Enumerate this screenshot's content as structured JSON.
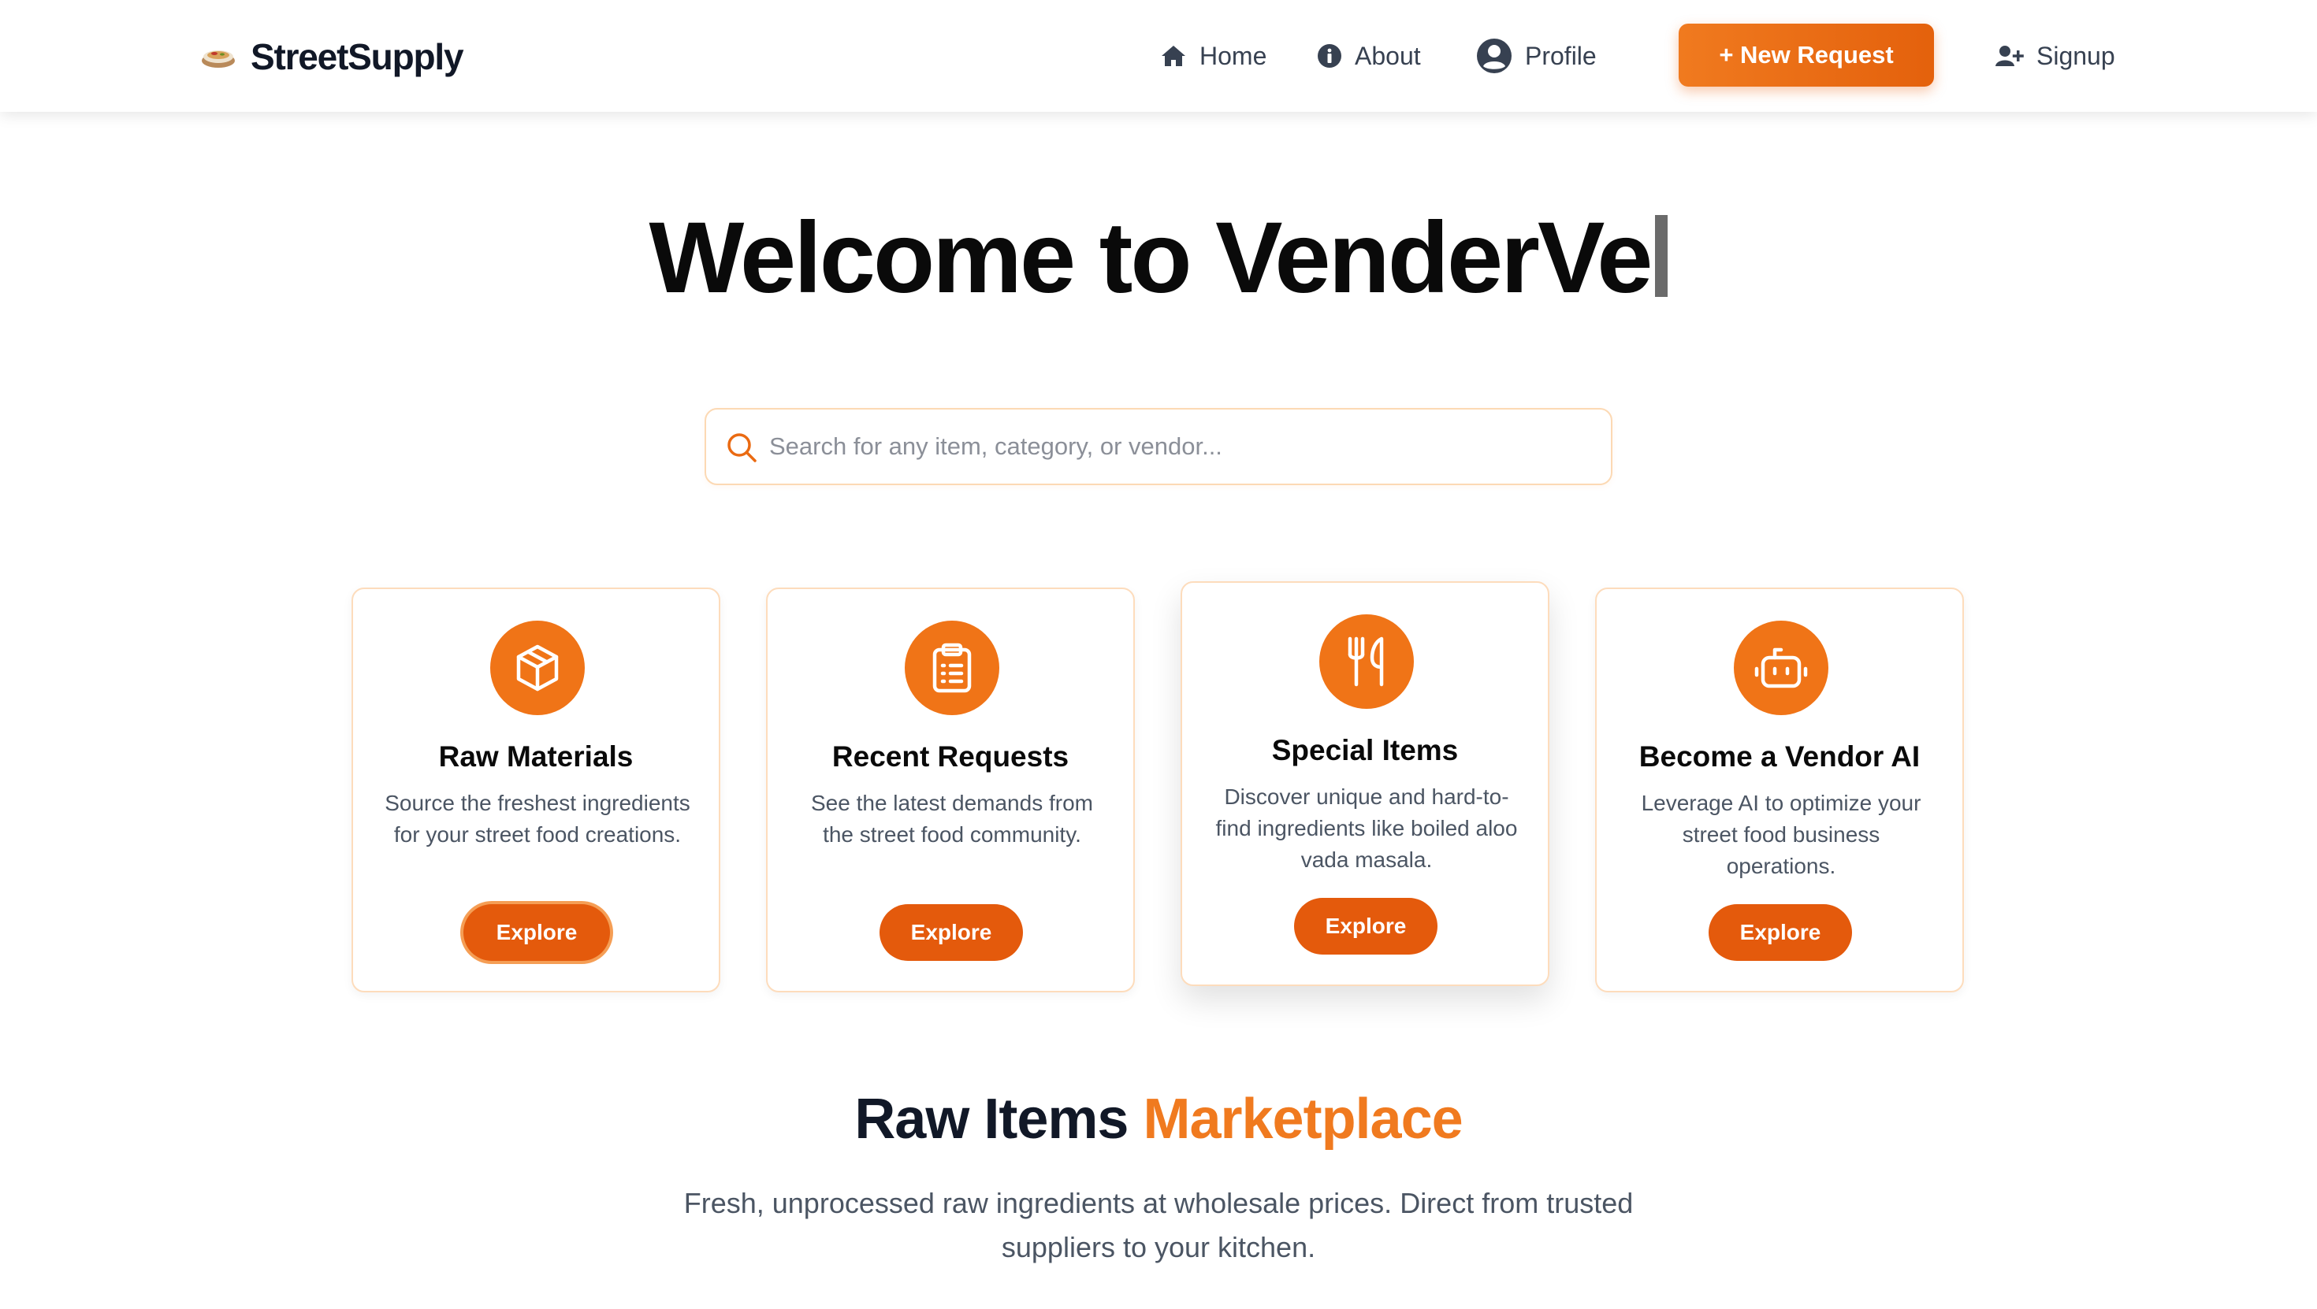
{
  "navbar": {
    "brand": "StreetSupply",
    "links": {
      "home": "Home",
      "about": "About",
      "profile": "Profile",
      "signup": "Signup"
    },
    "new_request": "+ New Request"
  },
  "hero": {
    "title": "Welcome to VenderVe"
  },
  "search": {
    "placeholder": "Search for any item, category, or vendor..."
  },
  "cards": [
    {
      "icon": "box-icon",
      "title": "Raw Materials",
      "description": "Source the freshest ingredients for your street food creations.",
      "button": "Explore"
    },
    {
      "icon": "clipboard-list-icon",
      "title": "Recent Requests",
      "description": "See the latest demands from the street food community.",
      "button": "Explore"
    },
    {
      "icon": "utensils-icon",
      "title": "Special Items",
      "description": "Discover unique and hard-to-find ingredients like boiled aloo vada masala.",
      "button": "Explore"
    },
    {
      "icon": "robot-icon",
      "title": "Become a Vendor AI",
      "description": "Leverage AI to optimize your street food business operations.",
      "button": "Explore"
    }
  ],
  "marketplace": {
    "title_main": "Raw Items",
    "title_accent": "Marketplace",
    "subtitle": "Fresh, unprocessed raw ingredients at wholesale prices. Direct from trusted suppliers to your kitchen."
  },
  "colors": {
    "accent": "#f07417",
    "button": "#e45a0c",
    "card_border": "#fddcbc",
    "text_dark": "#111827",
    "text_muted": "#4b5563"
  }
}
